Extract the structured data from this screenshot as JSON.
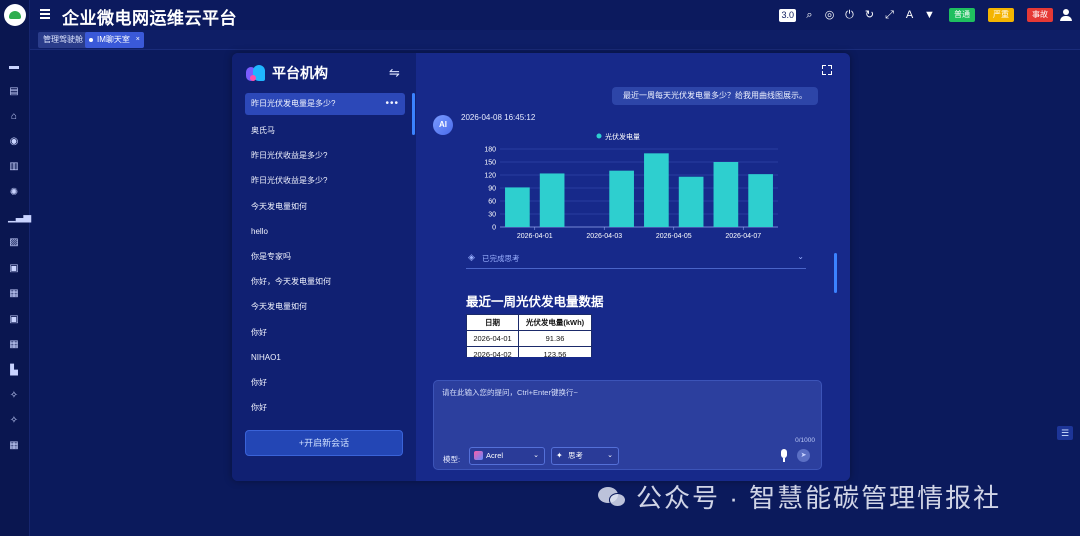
{
  "app": {
    "title": "企业微电网运维云平台",
    "version": "3.0"
  },
  "header": {
    "badges": [
      {
        "label": "普通",
        "count": "",
        "color": "#1fbf5f"
      },
      {
        "label": "严重",
        "count": "",
        "color": "#f4b400"
      },
      {
        "label": "事故",
        "count": "",
        "color": "#e53935"
      }
    ]
  },
  "tabs": [
    {
      "label": "管理驾驶舱",
      "active": false
    },
    {
      "label": "IM聊天室",
      "active": true,
      "close": "×"
    }
  ],
  "sidebar": {
    "brand": "平台机构",
    "conversations": [
      {
        "label": "昨日光伏发电量是多少?",
        "active": true
      },
      {
        "label": "奥氏马"
      },
      {
        "label": "昨日光伏收益是多少?"
      },
      {
        "label": "昨日光伏收益是多少?"
      },
      {
        "label": "今天发电量如何"
      },
      {
        "label": "hello"
      },
      {
        "label": "你是专家吗"
      },
      {
        "label": "你好，今天发电量如何"
      },
      {
        "label": "今天发电量如何"
      },
      {
        "label": "你好"
      },
      {
        "label": "NIHAO1"
      },
      {
        "label": "你好"
      },
      {
        "label": "你好"
      }
    ],
    "more": "•••",
    "new_chat": "+开启新会话"
  },
  "chat": {
    "user_message": "最近一周每天光伏发电量多少？给我用曲线图展示。",
    "ai_avatar": "AI",
    "ai_time": "2026-04-08 16:45:12",
    "thinking_label": "已完成思考",
    "section_title": "最近一周光伏发电量数据",
    "table": {
      "headers": [
        "日期",
        "光伏发电量(kWh)"
      ],
      "rows": [
        [
          "2026-04-01",
          "91.36"
        ],
        [
          "2026-04-02",
          "123.56"
        ]
      ]
    }
  },
  "input": {
    "placeholder": "请在此输入您的提问，Ctrl+Enter键换行~",
    "counter": "0/1000",
    "model_label": "模型:",
    "model_value": "Acrel",
    "think_value": "思考"
  },
  "watermark": "公众号 · 智慧能碳管理情报社",
  "chart_data": {
    "type": "bar",
    "legend": "光伏发电量",
    "legend_position": "top",
    "color": "#2ecfcf",
    "x": [
      "2026-04-01",
      "2026-04-02",
      "2026-04-03",
      "2026-04-04",
      "2026-04-05",
      "2026-04-06",
      "2026-04-07",
      "2026-04-08"
    ],
    "values": [
      91.36,
      123.56,
      null,
      130,
      170,
      116,
      150,
      122
    ],
    "x_tick_labels": [
      "2026-04-01",
      "2026-04-03",
      "2026-04-05",
      "2026-04-07"
    ],
    "y_ticks": [
      0,
      30,
      60,
      90,
      120,
      150,
      180
    ],
    "ylim": [
      0,
      180
    ],
    "grid": true
  }
}
